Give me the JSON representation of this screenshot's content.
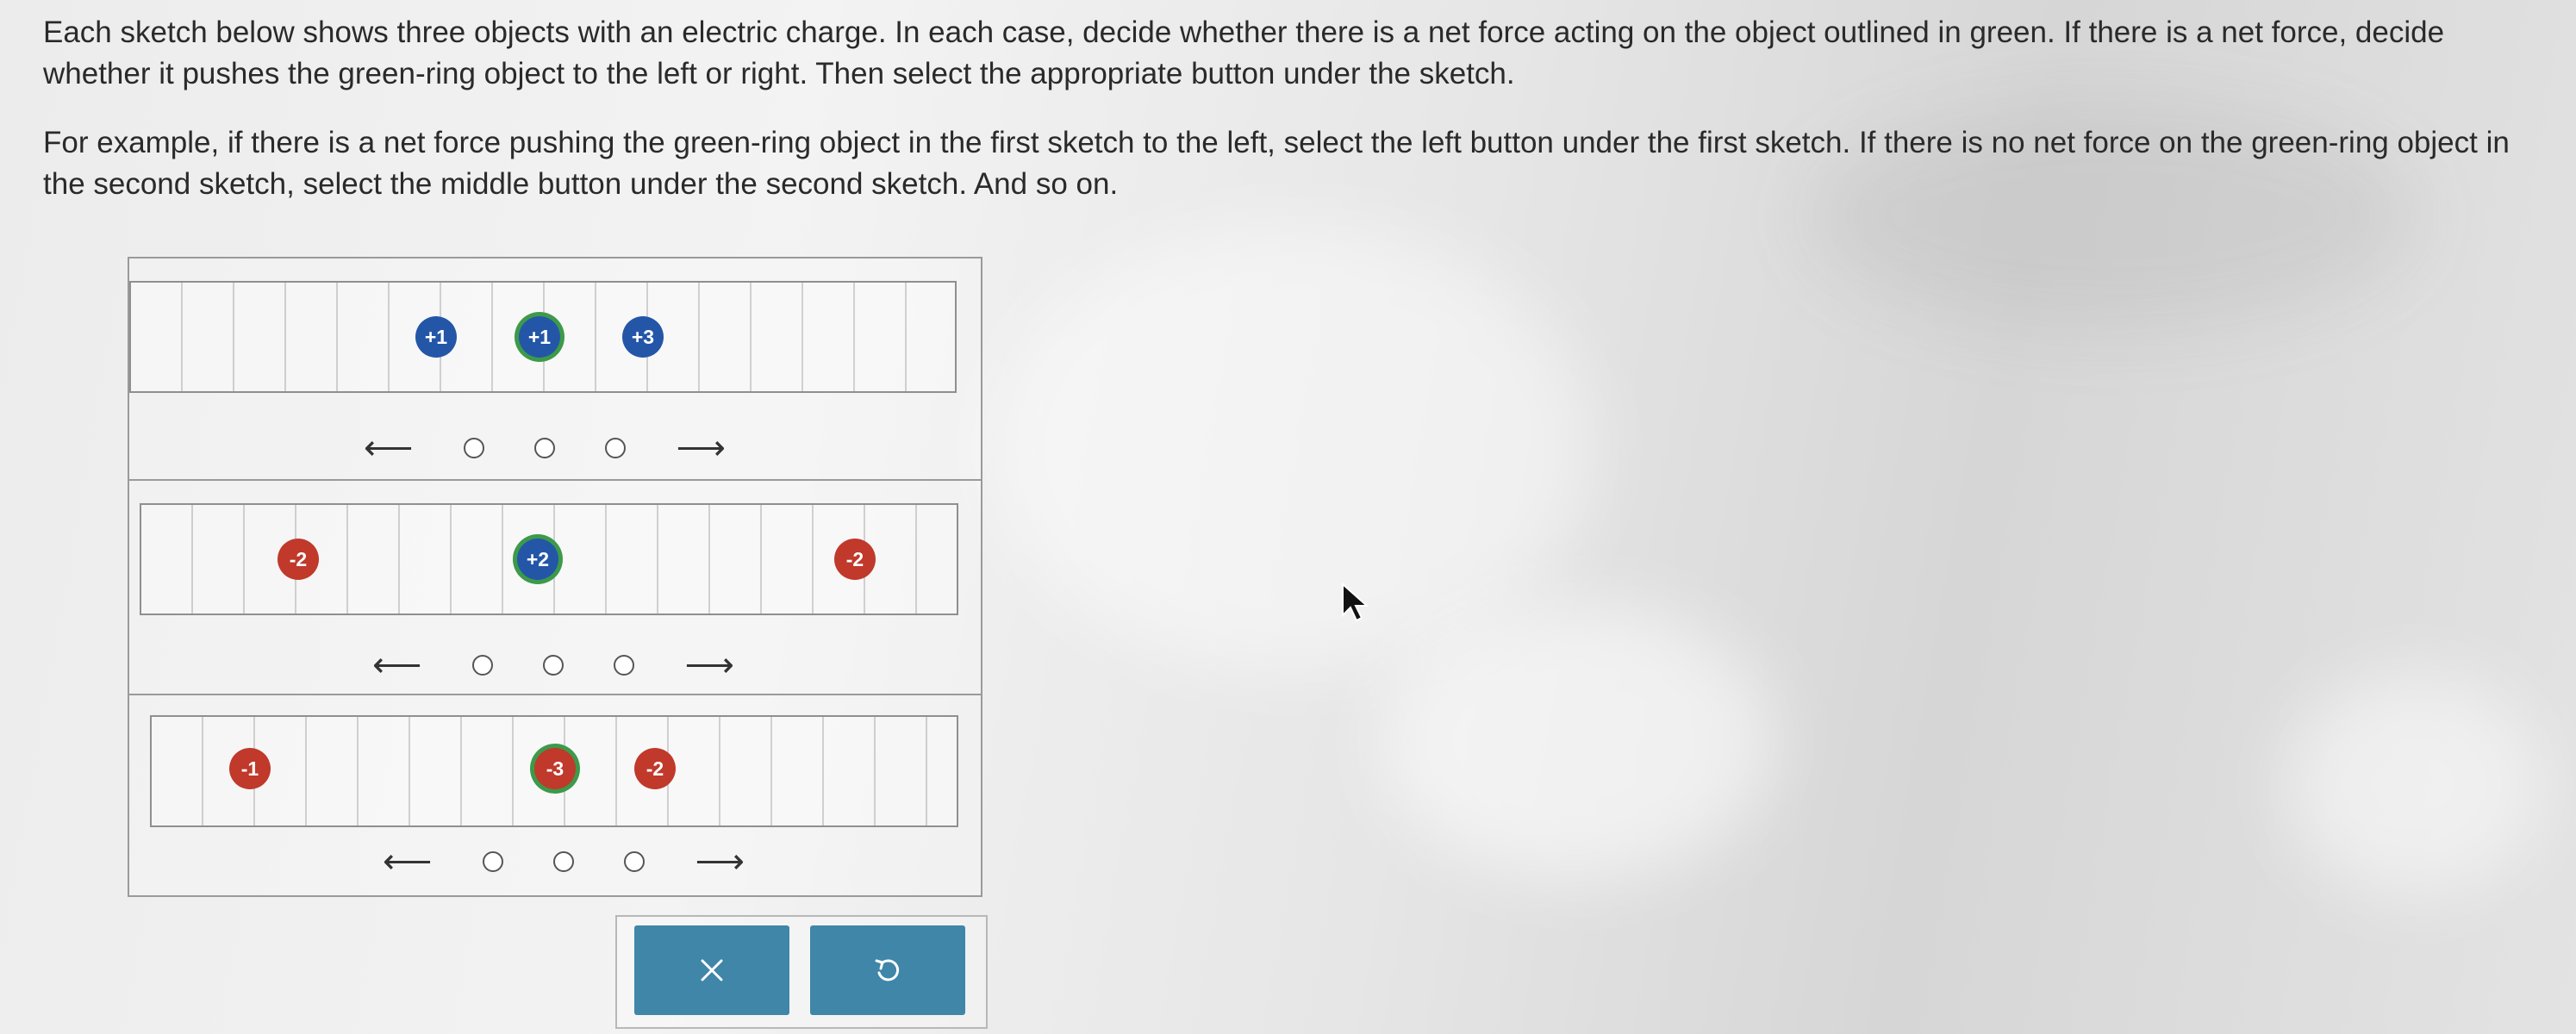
{
  "instructions": {
    "paragraph1": "Each sketch below shows three objects with an electric charge. In each case, decide whether there is a net force acting on the object outlined in green. If there is a net force, decide whether it pushes the green-ring object to the left or right. Then select the appropriate button under the sketch.",
    "paragraph2": "For example, if there is a net force pushing the green-ring object in the first sketch to the left, select the left button under the first sketch. If there is no net force on the green-ring object in the second sketch, select the middle button under the second sketch. And so on."
  },
  "colors": {
    "positive": "#2456a8",
    "negative": "#c0392b",
    "green_ring": "#3c9a4a",
    "button": "#3f86a8"
  },
  "sketches": [
    {
      "charges": [
        {
          "label": "+1"
        },
        {
          "label": "+1"
        },
        {
          "label": "+3"
        }
      ]
    },
    {
      "charges": [
        {
          "label": "-2"
        },
        {
          "label": "+2"
        },
        {
          "label": "-2"
        }
      ]
    },
    {
      "charges": [
        {
          "label": "-1"
        },
        {
          "label": "-3"
        },
        {
          "label": "-2"
        }
      ]
    }
  ],
  "arrows": {
    "left": "⟵",
    "right": "⟶"
  },
  "buttons": {
    "clear_icon": "x-icon",
    "reset_icon": "undo-icon"
  }
}
